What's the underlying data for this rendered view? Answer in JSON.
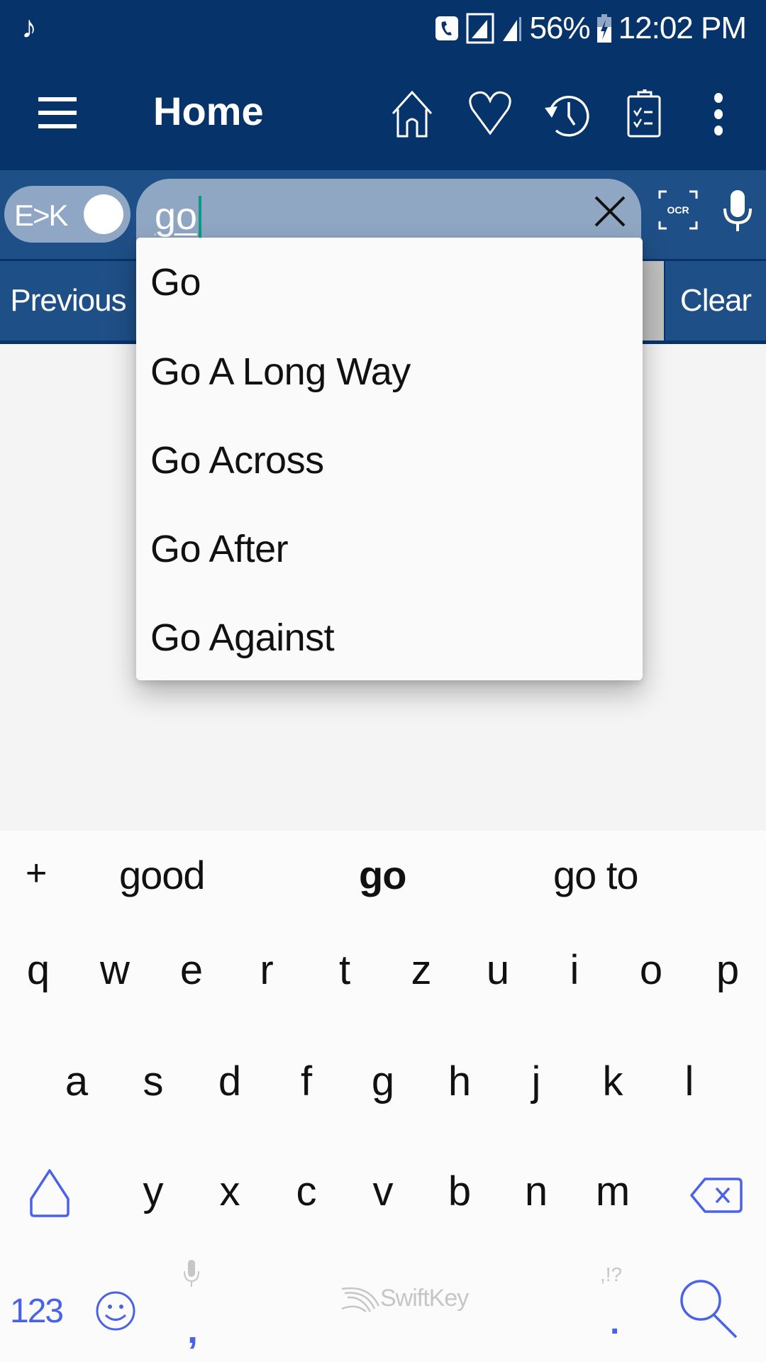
{
  "status_bar": {
    "notification_icon": "music-note-icon",
    "battery_percent": "56%",
    "time": "12:02 PM",
    "icons": [
      "wifi-calling-icon",
      "signal-sim1-icon",
      "signal-sim2-icon",
      "battery-charging-icon"
    ]
  },
  "app_bar": {
    "title": "Home",
    "actions": [
      "home-icon",
      "favorites-heart-icon",
      "history-icon",
      "clipboard-checklist-icon",
      "more-vert-icon"
    ]
  },
  "search": {
    "language_toggle_label": "E>K",
    "language_toggle_on": true,
    "query": "go",
    "ocr_label": "OCR"
  },
  "nav": {
    "previous_label": "Previous",
    "clear_label": "Clear"
  },
  "dropdown": {
    "items": [
      "Go",
      "Go A Long Way",
      "Go Across",
      "Go After",
      "Go Against"
    ]
  },
  "keyboard": {
    "suggestions": [
      "good",
      "go",
      "go to"
    ],
    "selected_suggestion": "go",
    "add_word": "+",
    "row1": [
      "q",
      "w",
      "e",
      "r",
      "t",
      "z",
      "u",
      "i",
      "o",
      "p"
    ],
    "row2": [
      "a",
      "s",
      "d",
      "f",
      "g",
      "h",
      "j",
      "k",
      "l"
    ],
    "row3": [
      "y",
      "x",
      "c",
      "v",
      "b",
      "n",
      "m"
    ],
    "numbers_label": "123",
    "comma": ",",
    "period": ".",
    "punct_hint": ",!?",
    "brand": "SwiftKey",
    "accent_color": "#4a62e8"
  },
  "colors": {
    "app_bar": "#07336b",
    "search_row": "#1f4f87",
    "search_field": "#90a7c4",
    "caret": "#0a9a86"
  }
}
